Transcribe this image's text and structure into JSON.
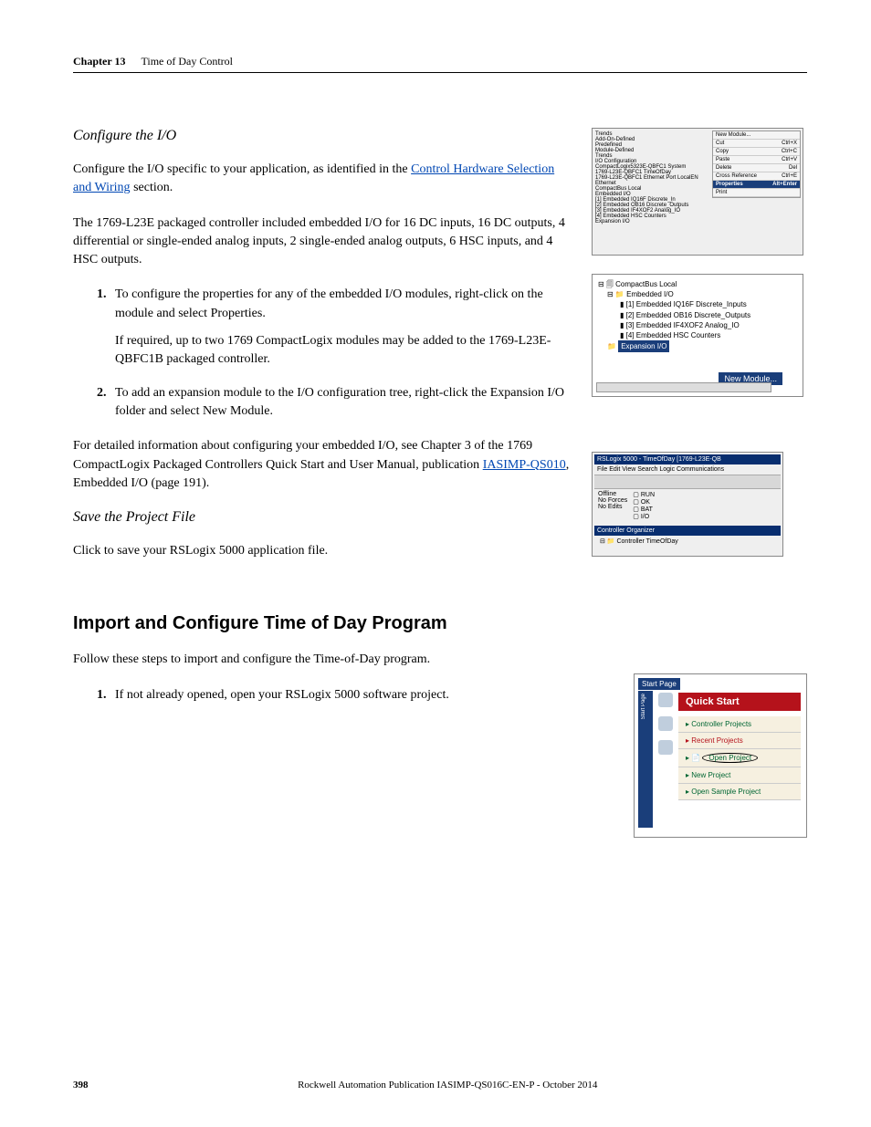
{
  "header": {
    "chapter_label": "Chapter 13",
    "chapter_title": "Time of Day Control"
  },
  "section1": {
    "heading": "Configure the I/O",
    "para1_a": "Configure the I/O specific to your application, as identified in the ",
    "link1": "Control Hardware Selection and Wiring",
    "para1_b": " section.",
    "para2": "The 1769-L23E packaged controller included embedded I/O for 16 DC inputs, 16 DC outputs, 4 differential or single-ended analog inputs, 2 single-ended analog outputs, 6 HSC inputs, and 4 HSC outputs.",
    "step1": "To configure the properties for any of the embedded I/O modules, right-click on the module and select Properties.",
    "step1_extra": "If required, up to two 1769 CompactLogix modules may be added to the 1769-L23E-QBFC1B packaged controller.",
    "step2": "To add an expansion module to the I/O configuration tree, right-click the Expansion I/O folder and select New Module.",
    "para3_a": "For detailed information about configuring your embedded I/O, see Chapter 3 of the 1769 CompactLogix Packaged Controllers Quick Start and User Manual, publication ",
    "link2": "IASIMP-QS010",
    "para3_b": ", Embedded I/O (page 191)."
  },
  "section2": {
    "heading": "Save the Project File",
    "para1": "Click to save your RSLogix 5000 application file."
  },
  "section3": {
    "heading": "Import and Configure Time of Day Program",
    "para1": "Follow these steps to import and configure the Time-of-Day program.",
    "step1": "If not already opened, open your RSLogix 5000 software project."
  },
  "fig1": {
    "menu_items": [
      {
        "l": "New Module...",
        "r": ""
      },
      {
        "l": "Cut",
        "r": "Ctrl+X"
      },
      {
        "l": "Copy",
        "r": "Ctrl+C"
      },
      {
        "l": "Paste",
        "r": "Ctrl+V"
      },
      {
        "l": "Delete",
        "r": "Del"
      },
      {
        "l": "Cross Reference",
        "r": "Ctrl+E"
      },
      {
        "l": "Properties",
        "r": "Alt+Enter"
      },
      {
        "l": "Print",
        "r": ""
      }
    ],
    "tree_items": [
      "Trends",
      "Add-On-Defined",
      "Predefined",
      "Module-Defined",
      "Trends",
      "I/O Configuration",
      "  CompactLogix5323E-QBFC1 System",
      "    1769-L23E-QBFC1 TimeOfDay",
      "    1769-L23E-QBFC1 Ethernet Port LocalEN",
      "      Ethernet",
      "  CompactBus Local",
      "    Embedded I/O",
      "      [1] Embedded IQ16F Discrete_In",
      "      [2] Embedded OB16 Discrete_Outputs",
      "      [3] Embedded IF4XOF2 Analog_IO",
      "      [4] Embedded HSC Counters",
      "    Expansion I/O"
    ]
  },
  "fig2": {
    "root": "CompactBus Local",
    "folder": "Embedded I/O",
    "items": [
      "[1] Embedded IQ16F Discrete_Inputs",
      "[2] Embedded OB16 Discrete_Outputs",
      "[3] Embedded IF4XOF2 Analog_IO",
      "[4] Embedded HSC Counters"
    ],
    "expansion": "Expansion I/O",
    "newmod": "New Module..."
  },
  "fig3": {
    "title": "RSLogix 5000 - TimeOfDay [1769-L23E-QB",
    "menubar": "File  Edit  View  Search  Logic  Communications",
    "status_left": [
      "Offline",
      "No Forces",
      "No Edits"
    ],
    "status_right": [
      "RUN",
      "OK",
      "BAT",
      "I/O"
    ],
    "org": "Controller Organizer",
    "ctl": "Controller TimeOfDay"
  },
  "fig4": {
    "tab": "Start Page",
    "side": "Start Page",
    "qs": "Quick Start",
    "rows": [
      {
        "text": "Controller Projects",
        "cls": "row"
      },
      {
        "text": "Recent Projects",
        "cls": "row red"
      },
      {
        "text": "Open Project",
        "cls": "row open"
      },
      {
        "text": "New Project",
        "cls": "row"
      },
      {
        "text": "Open Sample Project",
        "cls": "row"
      }
    ]
  },
  "footer": {
    "pageno": "398",
    "pub": "Rockwell Automation Publication IASIMP-QS016C-EN-P - October 2014"
  }
}
